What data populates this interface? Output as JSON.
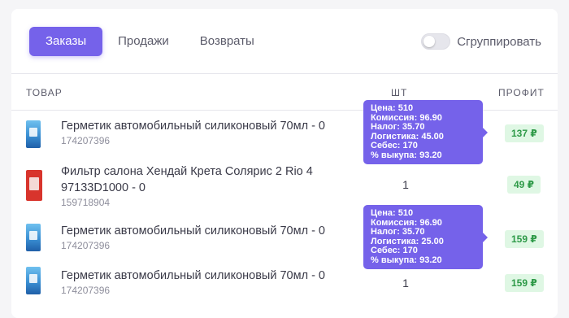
{
  "tabs": [
    {
      "label": "Заказы",
      "active": true
    },
    {
      "label": "Продажи",
      "active": false
    },
    {
      "label": "Возвраты",
      "active": false
    }
  ],
  "group_toggle": {
    "label": "Сгруппировать",
    "on": false
  },
  "columns": {
    "product": "ТОВАР",
    "qty": "ШТ",
    "profit": "ПРОФИТ"
  },
  "rows": [
    {
      "name_line1": "Герметик автомобильный силиконовый 70мл - 0",
      "name_line2": "",
      "sku": "174207396",
      "qty": "",
      "profit": "137 ₽",
      "tooltip": [
        "Цена: 510",
        "Комиссия: 96.90",
        "Налог: 35.70",
        "Логистика: 45.00",
        "Себес: 170",
        "% выкупа: 93.20"
      ]
    },
    {
      "name_line1": "Фильтр салона Хендай Крета Солярис 2 Rio 4",
      "name_line2": "97133D1000 - 0",
      "sku": "159718904",
      "qty": "1",
      "profit": "49 ₽"
    },
    {
      "name_line1": "Герметик автомобильный силиконовый 70мл - 0",
      "name_line2": "",
      "sku": "174207396",
      "qty": "",
      "profit": "159 ₽",
      "tooltip": [
        "Цена: 510",
        "Комиссия: 96.90",
        "Налог: 35.70",
        "Логистика: 25.00",
        "Себес: 170",
        "% выкупа: 93.20"
      ]
    },
    {
      "name_line1": "Герметик автомобильный силиконовый 70мл - 0",
      "name_line2": "",
      "sku": "174207396",
      "qty": "1",
      "profit": "159 ₽"
    }
  ],
  "colors": {
    "accent": "#7562ea",
    "profit_bg": "#dff7e4",
    "profit_text": "#2e9a48"
  }
}
